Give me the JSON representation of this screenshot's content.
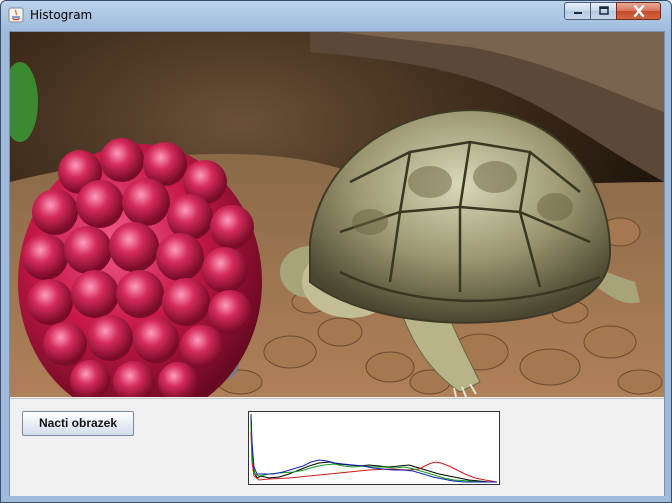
{
  "window": {
    "title": "Histogram",
    "minimize_glyph": "–",
    "maximize_glyph": "□",
    "close_glyph": "✕"
  },
  "controls": {
    "load_button_label": "Nacti obrazek"
  },
  "image": {
    "subject": "raspberry-and-tortoise-photo"
  },
  "histogram": {
    "series_colors": {
      "red": "#d01818",
      "green": "#10a010",
      "blue": "#1020c0",
      "gray": "#000000"
    }
  }
}
